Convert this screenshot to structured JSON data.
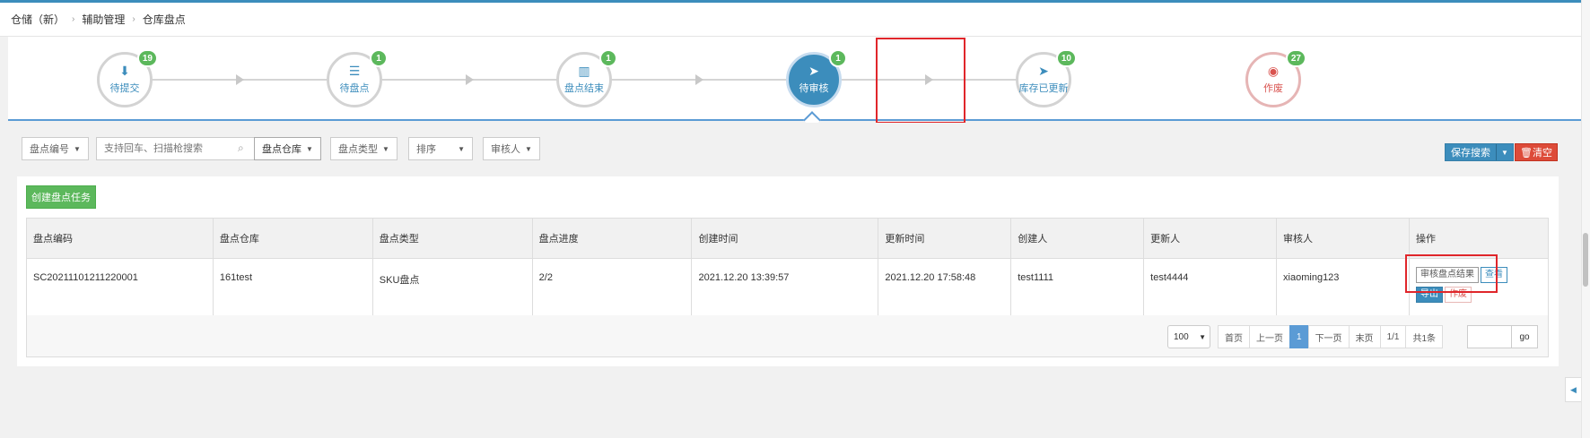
{
  "breadcrumb": {
    "items": [
      "仓储（新）",
      "辅助管理",
      "仓库盘点"
    ],
    "sep": "›"
  },
  "steps": [
    {
      "label": "待提交",
      "count": "19",
      "icon": "download-icon",
      "glyph": "⬇"
    },
    {
      "label": "待盘点",
      "count": "1",
      "icon": "list-icon",
      "glyph": "☰"
    },
    {
      "label": "盘点结束",
      "count": "1",
      "icon": "barcode-icon",
      "glyph": "▥"
    },
    {
      "label": "待审核",
      "count": "1",
      "icon": "send-icon",
      "glyph": "➤",
      "active": true
    },
    {
      "label": "库存已更新",
      "count": "10",
      "icon": "send-icon",
      "glyph": "➤"
    },
    {
      "label": "作废",
      "count": "27",
      "icon": "eye-slash-icon",
      "glyph": "◉"
    }
  ],
  "filters": {
    "code": "盘点编号",
    "search_placeholder": "支持回车、扫描枪搜索",
    "warehouse": "盘点仓库",
    "type": "盘点类型",
    "sort": "排序",
    "reviewer": "审核人",
    "save_search": "保存搜索",
    "clear": "清空"
  },
  "create_button": "创建盘点任务",
  "table": {
    "headers": [
      "盘点编码",
      "盘点仓库",
      "盘点类型",
      "盘点进度",
      "创建时间",
      "更新时间",
      "创建人",
      "更新人",
      "审核人",
      "操作"
    ],
    "rows": [
      {
        "code": "SC20211101211220001",
        "warehouse": "161test",
        "type": "SKU盘点",
        "progress": "2/2",
        "created": "2021.12.20 13:39:57",
        "updated": "2021.12.20 17:58:48",
        "creator": "test1111",
        "updater": "test4444",
        "reviewer": "xiaoming123",
        "actions": {
          "review": "审核盘点结果",
          "view": "查看",
          "export": "导出",
          "void": "作废"
        }
      }
    ]
  },
  "pager": {
    "page_size": "100",
    "first": "首页",
    "prev": "上一页",
    "current": "1",
    "next": "下一页",
    "last": "末页",
    "pages": "1/1",
    "total": "共1条",
    "go": "go"
  },
  "colors": {
    "primary": "#3c8dbc",
    "success": "#5cb85c",
    "danger": "#dd4b39",
    "highlight": "#e0262b"
  }
}
